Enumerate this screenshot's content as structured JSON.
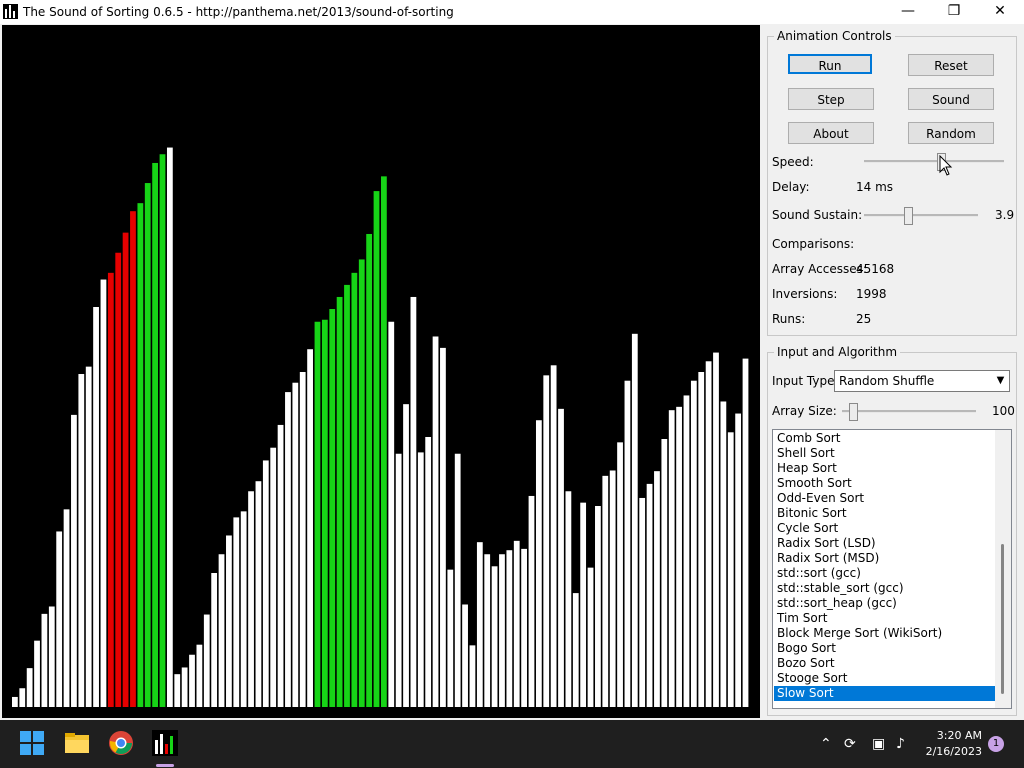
{
  "window": {
    "title": "The Sound of Sorting 0.6.5 - http://panthema.net/2013/sound-of-sorting",
    "min_icon": "minimize-icon",
    "max_icon": "restore-icon",
    "close_icon": "close-icon"
  },
  "visualization": {
    "colors": {
      "background": "#000000",
      "bar": "#ffffff",
      "highlight_red": "#e60000",
      "highlight_green": "#17d417"
    },
    "bars": [
      {
        "h": 0.015,
        "c": "w"
      },
      {
        "h": 0.028,
        "c": "w"
      },
      {
        "h": 0.058,
        "c": "w"
      },
      {
        "h": 0.099,
        "c": "w"
      },
      {
        "h": 0.139,
        "c": "w"
      },
      {
        "h": 0.15,
        "c": "w"
      },
      {
        "h": 0.262,
        "c": "w"
      },
      {
        "h": 0.295,
        "c": "w"
      },
      {
        "h": 0.436,
        "c": "w"
      },
      {
        "h": 0.497,
        "c": "w"
      },
      {
        "h": 0.508,
        "c": "w"
      },
      {
        "h": 0.597,
        "c": "w"
      },
      {
        "h": 0.638,
        "c": "w"
      },
      {
        "h": 0.648,
        "c": "r"
      },
      {
        "h": 0.678,
        "c": "r"
      },
      {
        "h": 0.708,
        "c": "r"
      },
      {
        "h": 0.74,
        "c": "r"
      },
      {
        "h": 0.752,
        "c": "g"
      },
      {
        "h": 0.782,
        "c": "g"
      },
      {
        "h": 0.812,
        "c": "g"
      },
      {
        "h": 0.825,
        "c": "g"
      },
      {
        "h": 0.835,
        "c": "w"
      },
      {
        "h": 0.049,
        "c": "w"
      },
      {
        "h": 0.059,
        "c": "w"
      },
      {
        "h": 0.078,
        "c": "w"
      },
      {
        "h": 0.093,
        "c": "w"
      },
      {
        "h": 0.138,
        "c": "w"
      },
      {
        "h": 0.2,
        "c": "w"
      },
      {
        "h": 0.228,
        "c": "w"
      },
      {
        "h": 0.256,
        "c": "w"
      },
      {
        "h": 0.283,
        "c": "w"
      },
      {
        "h": 0.292,
        "c": "w"
      },
      {
        "h": 0.322,
        "c": "w"
      },
      {
        "h": 0.337,
        "c": "w"
      },
      {
        "h": 0.368,
        "c": "w"
      },
      {
        "h": 0.387,
        "c": "w"
      },
      {
        "h": 0.421,
        "c": "w"
      },
      {
        "h": 0.47,
        "c": "w"
      },
      {
        "h": 0.484,
        "c": "w"
      },
      {
        "h": 0.5,
        "c": "w"
      },
      {
        "h": 0.534,
        "c": "w"
      },
      {
        "h": 0.575,
        "c": "g"
      },
      {
        "h": 0.578,
        "c": "g"
      },
      {
        "h": 0.594,
        "c": "g"
      },
      {
        "h": 0.612,
        "c": "g"
      },
      {
        "h": 0.63,
        "c": "g"
      },
      {
        "h": 0.648,
        "c": "g"
      },
      {
        "h": 0.668,
        "c": "g"
      },
      {
        "h": 0.706,
        "c": "g"
      },
      {
        "h": 0.77,
        "c": "g"
      },
      {
        "h": 0.792,
        "c": "g"
      },
      {
        "h": 0.575,
        "c": "w"
      },
      {
        "h": 0.378,
        "c": "w"
      },
      {
        "h": 0.452,
        "c": "w"
      },
      {
        "h": 0.612,
        "c": "w"
      },
      {
        "h": 0.38,
        "c": "w"
      },
      {
        "h": 0.403,
        "c": "w"
      },
      {
        "h": 0.553,
        "c": "w"
      },
      {
        "h": 0.536,
        "c": "w"
      },
      {
        "h": 0.205,
        "c": "w"
      },
      {
        "h": 0.378,
        "c": "w"
      },
      {
        "h": 0.153,
        "c": "w"
      },
      {
        "h": 0.092,
        "c": "w"
      },
      {
        "h": 0.246,
        "c": "w"
      },
      {
        "h": 0.228,
        "c": "w"
      },
      {
        "h": 0.21,
        "c": "w"
      },
      {
        "h": 0.228,
        "c": "w"
      },
      {
        "h": 0.234,
        "c": "w"
      },
      {
        "h": 0.248,
        "c": "w"
      },
      {
        "h": 0.236,
        "c": "w"
      },
      {
        "h": 0.315,
        "c": "w"
      },
      {
        "h": 0.428,
        "c": "w"
      },
      {
        "h": 0.495,
        "c": "w"
      },
      {
        "h": 0.51,
        "c": "w"
      },
      {
        "h": 0.445,
        "c": "w"
      },
      {
        "h": 0.322,
        "c": "w"
      },
      {
        "h": 0.17,
        "c": "w"
      },
      {
        "h": 0.305,
        "c": "w"
      },
      {
        "h": 0.208,
        "c": "w"
      },
      {
        "h": 0.3,
        "c": "w"
      },
      {
        "h": 0.345,
        "c": "w"
      },
      {
        "h": 0.353,
        "c": "w"
      },
      {
        "h": 0.395,
        "c": "w"
      },
      {
        "h": 0.487,
        "c": "w"
      },
      {
        "h": 0.557,
        "c": "w"
      },
      {
        "h": 0.312,
        "c": "w"
      },
      {
        "h": 0.333,
        "c": "w"
      },
      {
        "h": 0.352,
        "c": "w"
      },
      {
        "h": 0.4,
        "c": "w"
      },
      {
        "h": 0.443,
        "c": "w"
      },
      {
        "h": 0.448,
        "c": "w"
      },
      {
        "h": 0.465,
        "c": "w"
      },
      {
        "h": 0.487,
        "c": "w"
      },
      {
        "h": 0.5,
        "c": "w"
      },
      {
        "h": 0.516,
        "c": "w"
      },
      {
        "h": 0.529,
        "c": "w"
      },
      {
        "h": 0.456,
        "c": "w"
      },
      {
        "h": 0.41,
        "c": "w"
      },
      {
        "h": 0.438,
        "c": "w"
      },
      {
        "h": 0.52,
        "c": "w"
      }
    ]
  },
  "animation_controls": {
    "title": "Animation Controls",
    "run": "Run",
    "reset": "Reset",
    "step": "Step",
    "sound": "Sound",
    "about": "About",
    "random": "Random",
    "speed_label": "Speed:",
    "speed_level": 0.55,
    "delay_label": "Delay:",
    "delay_value": "14 ms",
    "sustain_label": "Sound Sustain:",
    "sustain_value": "3.9",
    "sustain_level": 0.39,
    "comparisons_label": "Comparisons:",
    "comparisons_value": "",
    "array_accesses_label": "Array Accesses:",
    "array_accesses_value": "45168",
    "inversions_label": "Inversions:",
    "inversions_value": "1998",
    "runs_label": "Runs:",
    "runs_value": "25"
  },
  "input_algorithm": {
    "title": "Input and Algorithm",
    "input_type_label": "Input Type:",
    "input_type_value": "Random Shuffle",
    "array_size_label": "Array Size:",
    "array_size_value": "100",
    "array_size_level": 0.08,
    "algorithms": [
      "Comb Sort",
      "Shell Sort",
      "Heap Sort",
      "Smooth Sort",
      "Odd-Even Sort",
      "Bitonic Sort",
      "Cycle Sort",
      "Radix Sort (LSD)",
      "Radix Sort (MSD)",
      "std::sort (gcc)",
      "std::stable_sort (gcc)",
      "std::sort_heap (gcc)",
      "Tim Sort",
      "Block Merge Sort (WikiSort)",
      "Bogo Sort",
      "Bozo Sort",
      "Stooge Sort",
      "Slow Sort"
    ],
    "selected_index": 17
  },
  "taskbar": {
    "time": "3:20 AM",
    "date": "2/16/2023",
    "notifications": "1",
    "icons": [
      "windows-start-icon",
      "file-explorer-icon",
      "chrome-icon",
      "sound-of-sorting-icon"
    ],
    "tray_icons": [
      "chevron-up-icon",
      "sync-icon",
      "display-icon",
      "speaker-icon"
    ]
  }
}
